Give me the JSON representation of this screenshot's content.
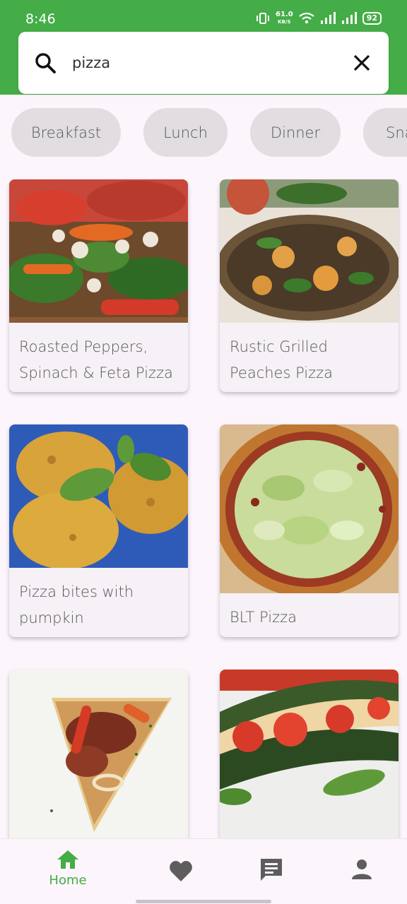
{
  "status_bar": {
    "time": "8:46",
    "net_speed_value": "61.0",
    "net_speed_unit": "KB/S",
    "battery": "92"
  },
  "search": {
    "value": "pizza",
    "icon": "search-icon",
    "clear_icon": "close-icon"
  },
  "chips": [
    "Breakfast",
    "Lunch",
    "Dinner",
    "Snacks"
  ],
  "recipes": [
    {
      "title": "Roasted Peppers, Spinach & Feta Pizza"
    },
    {
      "title": "Rustic Grilled Peaches Pizza"
    },
    {
      "title": "Pizza bites with pumpkin"
    },
    {
      "title": "BLT Pizza"
    },
    {
      "title": ""
    },
    {
      "title": ""
    }
  ],
  "bottom_nav": {
    "home_label": "Home",
    "items": [
      "home-icon",
      "heart-icon",
      "chat-icon",
      "person-icon"
    ],
    "active": "home"
  },
  "colors": {
    "primary": "#44ad47",
    "background": "#fcf5fc",
    "chip": "#e1dde1",
    "card": "#f6f1f6"
  }
}
